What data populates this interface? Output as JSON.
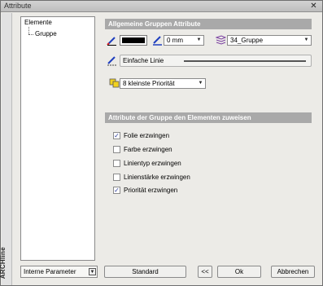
{
  "window": {
    "title": "Attribute",
    "close_glyph": "✕"
  },
  "brand": {
    "text": "ARCHline"
  },
  "tree": {
    "items": [
      "Elemente",
      "Gruppe"
    ]
  },
  "group_attributes": {
    "header": "Allgemeine Gruppen Attribute",
    "color_swatch": "#000000",
    "line_width": "0 mm",
    "layer": "34_Gruppe",
    "line_type": "Einfache Linie",
    "priority": "8 kleinste Priorität"
  },
  "assign_section": {
    "header": "Attribute der Gruppe den Elementen zuweisen",
    "options": [
      {
        "label": "Folie erzwingen",
        "checked": true
      },
      {
        "label": "Farbe erzwingen",
        "checked": false
      },
      {
        "label": "Linientyp erzwingen",
        "checked": false
      },
      {
        "label": "Linienstärke erzwingen",
        "checked": false
      },
      {
        "label": "Priorität erzwingen",
        "checked": true
      }
    ]
  },
  "footer": {
    "params_select": "Interne Parameter",
    "standard": "Standard",
    "back": "<<",
    "ok": "Ok",
    "cancel": "Abbrechen"
  },
  "colors": {
    "header_bg": "#a9a9a9",
    "dialog_bg": "#ecebe7",
    "pen_blue": "#1f3fbf"
  }
}
